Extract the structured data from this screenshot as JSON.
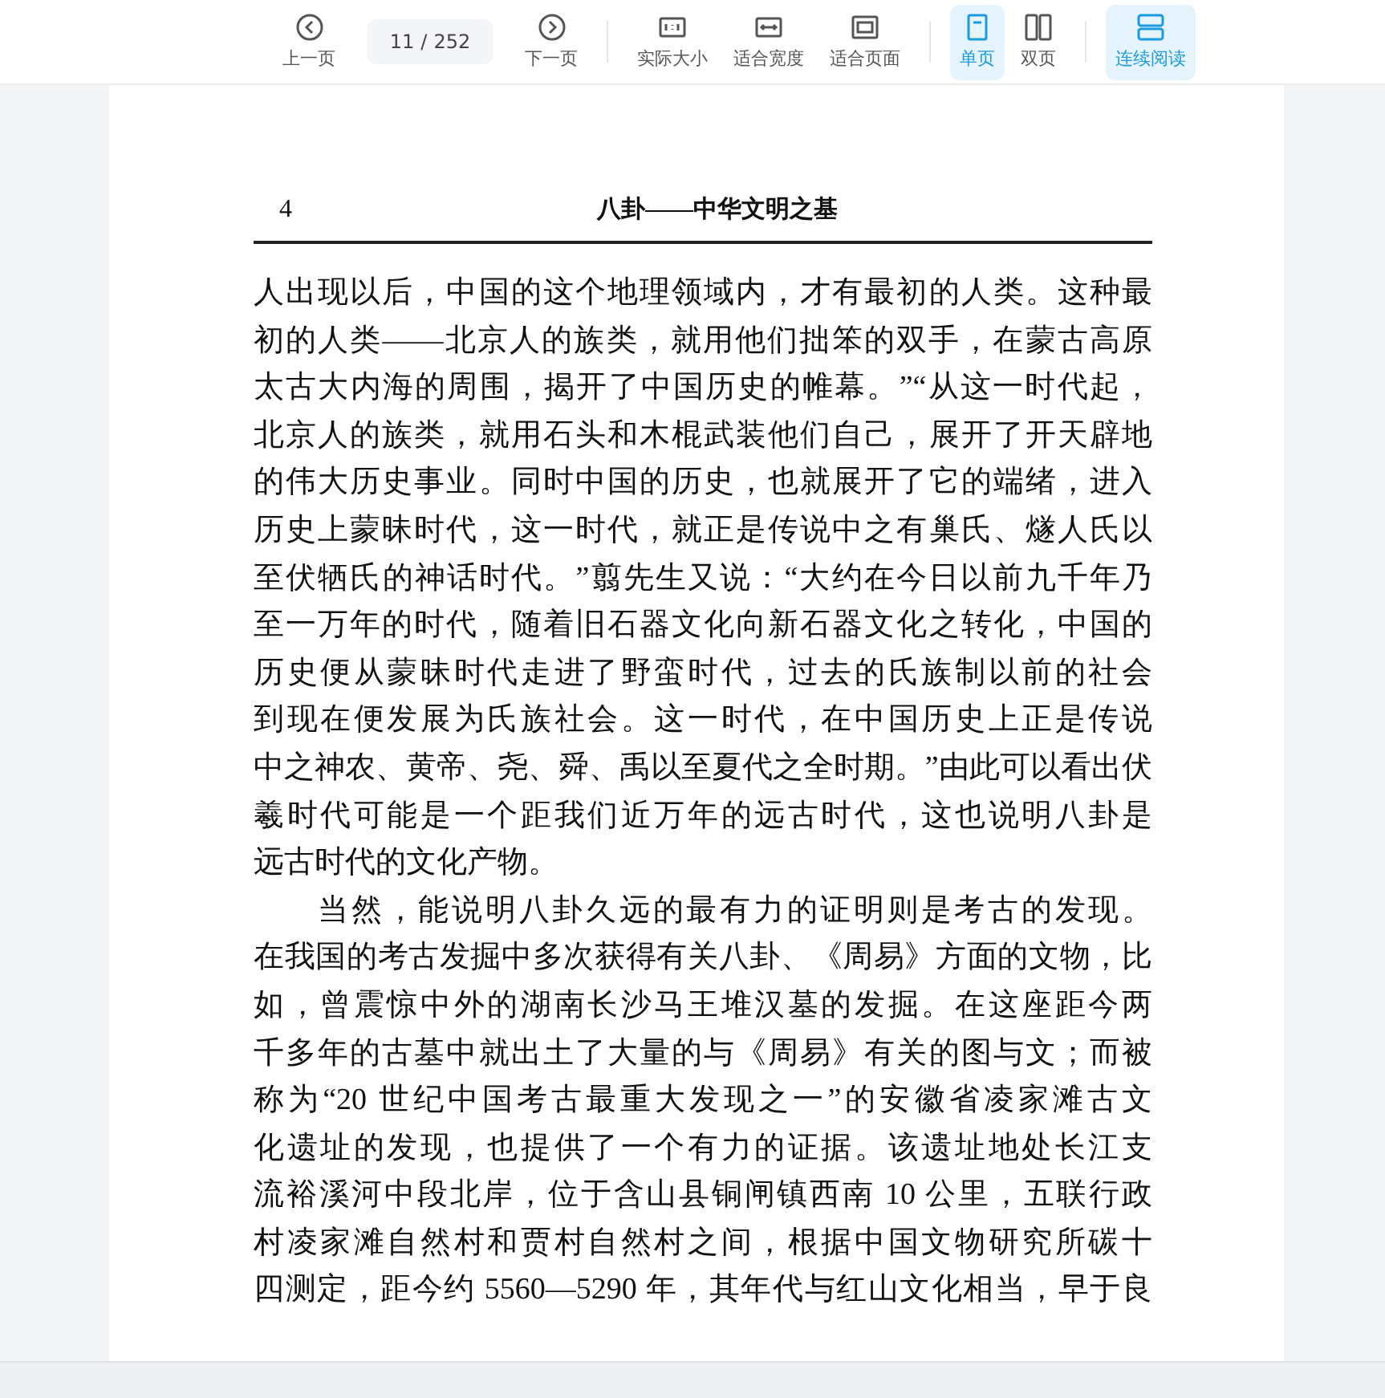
{
  "toolbar": {
    "navigation": [
      {
        "kind": "prev",
        "label": "上一页"
      },
      {
        "kind": "page",
        "current": "11",
        "separator": "/",
        "total": "252"
      },
      {
        "kind": "next",
        "label": "下一页"
      }
    ],
    "zoom": [
      {
        "kind": "actual-size",
        "label": "实际大小",
        "selected": false
      },
      {
        "kind": "fit-width",
        "label": "适合宽度",
        "selected": false
      },
      {
        "kind": "fit-page",
        "label": "适合页面",
        "selected": false
      }
    ],
    "layout": [
      {
        "kind": "single",
        "label": "单页",
        "selected": true
      },
      {
        "kind": "double",
        "label": "双页",
        "selected": false
      }
    ],
    "scroll": [
      {
        "kind": "continuous",
        "label": "连续阅读",
        "selected": true
      }
    ]
  },
  "page": {
    "number": "4",
    "running_title": "八卦——中华文明之基",
    "paragraphs": [
      {
        "indent": false,
        "lines": [
          "人出现以后，中国的这个地理领域内，才有最初的人类。这种最",
          "初的人类——北京人的族类，就用他们拙笨的双手，在蒙古高原",
          "太古大内海的周围，揭开了中国历史的帷幕。”“从这一时代起，",
          "北京人的族类，就用石头和木棍武装他们自己，展开了开天辟地",
          "的伟大历史事业。同时中国的历史，也就展开了它的端绪，进入",
          "历史上蒙昧时代，这一时代，就正是传说中之有巢氏、燧人氏以",
          "至伏牺氏的神话时代。”翦先生又说：“大约在今日以前九千年乃",
          "至一万年的时代，随着旧石器文化向新石器文化之转化，中国的",
          "历史便从蒙昧时代走进了野蛮时代，过去的氏族制以前的社会",
          "到现在便发展为氏族社会。这一时代，在中国历史上正是传说",
          "中之神农、黄帝、尧、舜、禹以至夏代之全时期。”由此可以看出伏",
          "羲时代可能是一个距我们近万年的远古时代，这也说明八卦是",
          "远古时代的文化产物。"
        ]
      },
      {
        "indent": true,
        "lines": [
          "当然，能说明八卦久远的最有力的证明则是考古的发现。",
          "在我国的考古发掘中多次获得有关八卦、《周易》方面的文物，比",
          "如，曾震惊中外的湖南长沙马王堆汉墓的发掘。在这座距今两",
          "千多年的古墓中就出土了大量的与《周易》有关的图与文；而被",
          "称为“20 世纪中国考古最重大发现之一”的安徽省凌家滩古文",
          "化遗址的发现，也提供了一个有力的证据。该遗址地处长江支",
          "流裕溪河中段北岸，位于含山县铜闸镇西南 10 公里，五联行政",
          "村凌家滩自然村和贾村自然村之间，根据中国文物研究所碳十",
          "四测定，距今约 5560—5290 年，其年代与红山文化相当，早于良"
        ]
      }
    ]
  }
}
